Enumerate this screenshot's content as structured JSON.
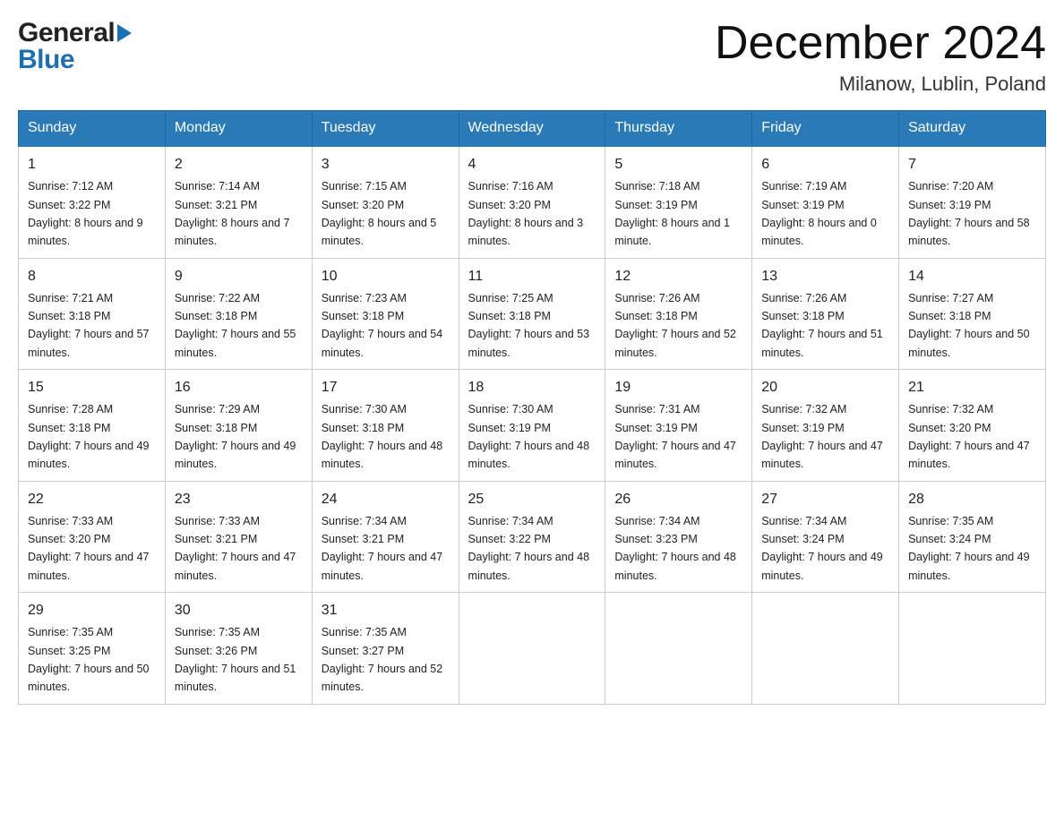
{
  "header": {
    "logo_general": "General",
    "logo_blue": "Blue",
    "month_title": "December 2024",
    "location": "Milanow, Lublin, Poland"
  },
  "weekdays": [
    "Sunday",
    "Monday",
    "Tuesday",
    "Wednesday",
    "Thursday",
    "Friday",
    "Saturday"
  ],
  "weeks": [
    [
      {
        "day": "1",
        "sunrise": "7:12 AM",
        "sunset": "3:22 PM",
        "daylight": "8 hours and 9 minutes."
      },
      {
        "day": "2",
        "sunrise": "7:14 AM",
        "sunset": "3:21 PM",
        "daylight": "8 hours and 7 minutes."
      },
      {
        "day": "3",
        "sunrise": "7:15 AM",
        "sunset": "3:20 PM",
        "daylight": "8 hours and 5 minutes."
      },
      {
        "day": "4",
        "sunrise": "7:16 AM",
        "sunset": "3:20 PM",
        "daylight": "8 hours and 3 minutes."
      },
      {
        "day": "5",
        "sunrise": "7:18 AM",
        "sunset": "3:19 PM",
        "daylight": "8 hours and 1 minute."
      },
      {
        "day": "6",
        "sunrise": "7:19 AM",
        "sunset": "3:19 PM",
        "daylight": "8 hours and 0 minutes."
      },
      {
        "day": "7",
        "sunrise": "7:20 AM",
        "sunset": "3:19 PM",
        "daylight": "7 hours and 58 minutes."
      }
    ],
    [
      {
        "day": "8",
        "sunrise": "7:21 AM",
        "sunset": "3:18 PM",
        "daylight": "7 hours and 57 minutes."
      },
      {
        "day": "9",
        "sunrise": "7:22 AM",
        "sunset": "3:18 PM",
        "daylight": "7 hours and 55 minutes."
      },
      {
        "day": "10",
        "sunrise": "7:23 AM",
        "sunset": "3:18 PM",
        "daylight": "7 hours and 54 minutes."
      },
      {
        "day": "11",
        "sunrise": "7:25 AM",
        "sunset": "3:18 PM",
        "daylight": "7 hours and 53 minutes."
      },
      {
        "day": "12",
        "sunrise": "7:26 AM",
        "sunset": "3:18 PM",
        "daylight": "7 hours and 52 minutes."
      },
      {
        "day": "13",
        "sunrise": "7:26 AM",
        "sunset": "3:18 PM",
        "daylight": "7 hours and 51 minutes."
      },
      {
        "day": "14",
        "sunrise": "7:27 AM",
        "sunset": "3:18 PM",
        "daylight": "7 hours and 50 minutes."
      }
    ],
    [
      {
        "day": "15",
        "sunrise": "7:28 AM",
        "sunset": "3:18 PM",
        "daylight": "7 hours and 49 minutes."
      },
      {
        "day": "16",
        "sunrise": "7:29 AM",
        "sunset": "3:18 PM",
        "daylight": "7 hours and 49 minutes."
      },
      {
        "day": "17",
        "sunrise": "7:30 AM",
        "sunset": "3:18 PM",
        "daylight": "7 hours and 48 minutes."
      },
      {
        "day": "18",
        "sunrise": "7:30 AM",
        "sunset": "3:19 PM",
        "daylight": "7 hours and 48 minutes."
      },
      {
        "day": "19",
        "sunrise": "7:31 AM",
        "sunset": "3:19 PM",
        "daylight": "7 hours and 47 minutes."
      },
      {
        "day": "20",
        "sunrise": "7:32 AM",
        "sunset": "3:19 PM",
        "daylight": "7 hours and 47 minutes."
      },
      {
        "day": "21",
        "sunrise": "7:32 AM",
        "sunset": "3:20 PM",
        "daylight": "7 hours and 47 minutes."
      }
    ],
    [
      {
        "day": "22",
        "sunrise": "7:33 AM",
        "sunset": "3:20 PM",
        "daylight": "7 hours and 47 minutes."
      },
      {
        "day": "23",
        "sunrise": "7:33 AM",
        "sunset": "3:21 PM",
        "daylight": "7 hours and 47 minutes."
      },
      {
        "day": "24",
        "sunrise": "7:34 AM",
        "sunset": "3:21 PM",
        "daylight": "7 hours and 47 minutes."
      },
      {
        "day": "25",
        "sunrise": "7:34 AM",
        "sunset": "3:22 PM",
        "daylight": "7 hours and 48 minutes."
      },
      {
        "day": "26",
        "sunrise": "7:34 AM",
        "sunset": "3:23 PM",
        "daylight": "7 hours and 48 minutes."
      },
      {
        "day": "27",
        "sunrise": "7:34 AM",
        "sunset": "3:24 PM",
        "daylight": "7 hours and 49 minutes."
      },
      {
        "day": "28",
        "sunrise": "7:35 AM",
        "sunset": "3:24 PM",
        "daylight": "7 hours and 49 minutes."
      }
    ],
    [
      {
        "day": "29",
        "sunrise": "7:35 AM",
        "sunset": "3:25 PM",
        "daylight": "7 hours and 50 minutes."
      },
      {
        "day": "30",
        "sunrise": "7:35 AM",
        "sunset": "3:26 PM",
        "daylight": "7 hours and 51 minutes."
      },
      {
        "day": "31",
        "sunrise": "7:35 AM",
        "sunset": "3:27 PM",
        "daylight": "7 hours and 52 minutes."
      },
      null,
      null,
      null,
      null
    ]
  ]
}
